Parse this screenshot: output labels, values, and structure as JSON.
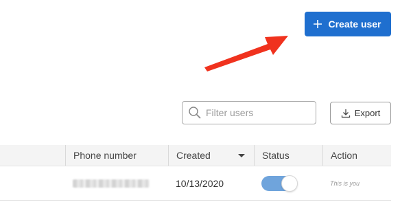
{
  "toolbar": {
    "create_label": "Create user",
    "create_icon": "plus-icon",
    "filter_placeholder": "Filter users",
    "filter_value": "",
    "filter_icon": "search-icon",
    "export_label": "Export",
    "export_icon": "download-icon"
  },
  "annotation": {
    "arrow_color": "#f0321e",
    "points_to": "create-user-button"
  },
  "table": {
    "columns": [
      {
        "label": "Phone number"
      },
      {
        "label": "Created",
        "sorted": "descending"
      },
      {
        "label": "Status"
      },
      {
        "label": "Action"
      }
    ],
    "rows": [
      {
        "phone_number": "",
        "phone_redacted": true,
        "created": "10/13/2020",
        "status_enabled": true,
        "action": "This is you"
      }
    ]
  },
  "colors": {
    "primary": "#1f6fcf",
    "toggle_on": "#6fa4dc",
    "header_bg": "#f4f4f4",
    "annotation_arrow": "#f0321e"
  }
}
